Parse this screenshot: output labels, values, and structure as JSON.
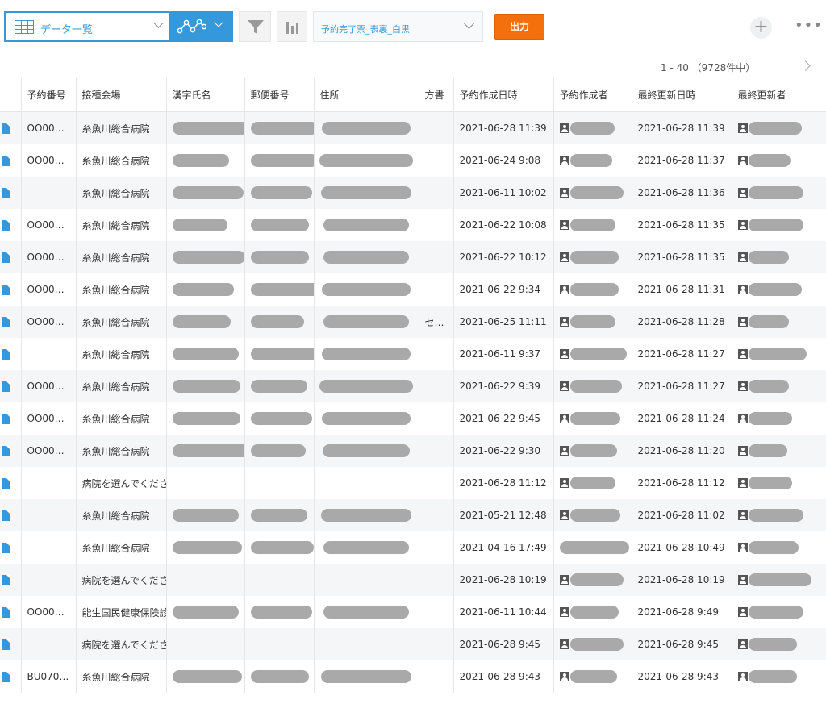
{
  "toolbar": {
    "view_label": "データ一覧",
    "view_icon": "table-icon",
    "graph_icon": "line-graph-icon",
    "filter_icon": "filter-icon",
    "bars_icon": "bar-chart-icon",
    "print_label": "予約完了票_表裏_白黒",
    "export_label": "出力",
    "add_symbol": "+",
    "more_symbol": "•••"
  },
  "colors": {
    "accent": "#3498db",
    "export": "#f4700d"
  },
  "pager": {
    "count": "1 - 40 （9728件中）"
  },
  "table": {
    "headers": [
      "予約番号",
      "接種会場",
      "漢字氏名",
      "郵便番号",
      "住所",
      "方書",
      "予約作成日時",
      "予約作成者",
      "最終更新日時",
      "最終更新者"
    ],
    "rows": [
      {
        "id": "OO00…",
        "venue": "糸魚川総合病院",
        "katagaki": "",
        "created": "2021-06-28 11:39",
        "updated": "2021-06-28 11:39",
        "w": [
          95,
          83,
          110,
          55,
          66
        ]
      },
      {
        "id": "OO00…",
        "venue": "糸魚川総合病院",
        "katagaki": "",
        "created": "2021-06-24 9:08",
        "updated": "2021-06-28 11:37",
        "w": [
          70,
          83,
          116,
          52,
          52
        ]
      },
      {
        "id": "",
        "venue": "糸魚川総合病院",
        "katagaki": "",
        "created": "2021-06-11 10:02",
        "updated": "2021-06-28 11:36",
        "w": [
          88,
          76,
          112,
          66,
          68
        ]
      },
      {
        "id": "OO00…",
        "venue": "糸魚川総合病院",
        "katagaki": "",
        "created": "2021-06-22 10:08",
        "updated": "2021-06-28 11:35",
        "w": [
          68,
          72,
          106,
          56,
          68
        ]
      },
      {
        "id": "OO00…",
        "venue": "糸魚川総合病院",
        "katagaki": "",
        "created": "2021-06-22 10:12",
        "updated": "2021-06-28 11:35",
        "w": [
          90,
          72,
          106,
          60,
          50
        ]
      },
      {
        "id": "OO00…",
        "venue": "糸魚川総合病院",
        "katagaki": "",
        "created": "2021-06-22 9:34",
        "updated": "2021-06-28 11:31",
        "w": [
          76,
          86,
          110,
          60,
          66
        ]
      },
      {
        "id": "OO00…",
        "venue": "糸魚川総合病院",
        "katagaki": "セ…",
        "created": "2021-06-25 11:11",
        "updated": "2021-06-28 11:28",
        "w": [
          72,
          66,
          106,
          56,
          50
        ]
      },
      {
        "id": "",
        "venue": "糸魚川総合病院",
        "katagaki": "",
        "created": "2021-06-11 9:37",
        "updated": "2021-06-28 11:27",
        "w": [
          82,
          84,
          110,
          70,
          72
        ]
      },
      {
        "id": "OO00…",
        "venue": "糸魚川総合病院",
        "katagaki": "",
        "created": "2021-06-22 9:39",
        "updated": "2021-06-28 11:27",
        "w": [
          84,
          70,
          116,
          64,
          50
        ]
      },
      {
        "id": "OO00…",
        "venue": "糸魚川総合病院",
        "katagaki": "",
        "created": "2021-06-22 9:45",
        "updated": "2021-06-28 11:24",
        "w": [
          84,
          76,
          110,
          62,
          54
        ]
      },
      {
        "id": "OO00…",
        "venue": "糸魚川総合病院",
        "katagaki": "",
        "created": "2021-06-22 9:30",
        "updated": "2021-06-28 11:20",
        "w": [
          95,
          68,
          108,
          58,
          48
        ]
      },
      {
        "id": "",
        "venue": "病院を選んでくださ",
        "katagaki": "",
        "created": "2021-06-28 11:12",
        "updated": "2021-06-28 11:12",
        "w": [
          0,
          0,
          0,
          56,
          54
        ]
      },
      {
        "id": "",
        "venue": "糸魚川総合病院",
        "katagaki": "",
        "created": "2021-05-21 12:48",
        "updated": "2021-06-28 11:02",
        "w": [
          82,
          70,
          112,
          62,
          68
        ]
      },
      {
        "id": "",
        "venue": "糸魚川総合病院",
        "katagaki": "",
        "created": "2021-04-16 17:49",
        "updated": "2021-06-28 10:49",
        "w": [
          86,
          78,
          106,
          86,
          62
        ]
      },
      {
        "id": "",
        "venue": "病院を選んでくださ",
        "katagaki": "",
        "created": "2021-06-28 10:19",
        "updated": "2021-06-28 10:19",
        "w": [
          0,
          0,
          0,
          66,
          78
        ]
      },
      {
        "id": "OO00…",
        "venue": "能生国民健康保険診",
        "katagaki": "",
        "created": "2021-06-11 10:44",
        "updated": "2021-06-28 9:49",
        "w": [
          82,
          76,
          106,
          60,
          68
        ]
      },
      {
        "id": "",
        "venue": "病院を選んでくださ",
        "katagaki": "",
        "created": "2021-06-28 9:45",
        "updated": "2021-06-28 9:45",
        "w": [
          0,
          0,
          0,
          66,
          60
        ]
      },
      {
        "id": "BU070…",
        "venue": "糸魚川総合病院",
        "katagaki": "",
        "created": "2021-06-28 9:43",
        "updated": "2021-06-28 9:43",
        "w": [
          86,
          72,
          112,
          58,
          60
        ]
      }
    ]
  }
}
